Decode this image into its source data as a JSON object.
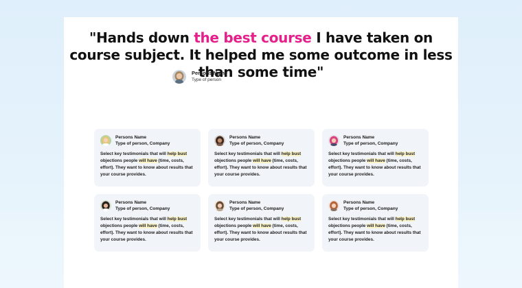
{
  "hero": {
    "quote_part1": "\"Hands down ",
    "quote_highlight": "the best course",
    "quote_part2": " I have taken on course subject. It helped me some outcome in less than some time\"",
    "person_name": "Persons Name",
    "person_type": "Type of person",
    "avatar_icon": "woman-portrait-avatar"
  },
  "colors": {
    "accent": "#e5208a",
    "card_bg": "#f1f4f8",
    "highlight": "#fbf3c8"
  },
  "testimonials": [
    {
      "name": "Persons Name",
      "type": "Type of person, Company",
      "text_a": "Select key testimonials that will ",
      "text_mark1": "help bust",
      "text_b": " objections people ",
      "text_mark2": "will have",
      "text_c": " (time, costs, effort). They want to know about results that your course provides.",
      "avatar_icon": "blonde-woman-avatar"
    },
    {
      "name": "Persons Name",
      "type": "Type of person, Company",
      "text_a": "Select key testimonials that will ",
      "text_mark1": "help bust",
      "text_b": " objections people ",
      "text_mark2": "will have",
      "text_c": " (time, costs, effort). They want to know about results that your course provides.",
      "avatar_icon": "curly-hair-woman-avatar"
    },
    {
      "name": "Persons Name",
      "type": "Type of person, Company",
      "text_a": "Select key testimonials that will ",
      "text_mark1": "help bust",
      "text_b": " objections people ",
      "text_mark2": "will have",
      "text_c": " (time, costs, effort). They want to know about results that your course provides.",
      "avatar_icon": "pink-hair-woman-avatar"
    },
    {
      "name": "Persons Name",
      "type": "Type of person, Company",
      "text_a": "Select key testimonials that will ",
      "text_mark1": "help bust",
      "text_b": " objections people ",
      "text_mark2": "will have",
      "text_c": " (time, costs, effort). They want to know about results that your course provides.",
      "avatar_icon": "dark-hair-woman-avatar"
    },
    {
      "name": "Persons Name",
      "type": "Type of person, Company",
      "text_a": "Select key testimonials that will ",
      "text_mark1": "help bust",
      "text_b": " objections people ",
      "text_mark2": "will have",
      "text_c": " (time, costs, effort). They want to know about results that your course provides.",
      "avatar_icon": "brown-hair-woman-avatar"
    },
    {
      "name": "Persons Name",
      "type": "Type of person, Company",
      "text_a": "Select key testimonials that will ",
      "text_mark1": "help bust",
      "text_b": " objections people ",
      "text_mark2": "will have",
      "text_c": " (time, costs, effort). They want to know about results that your course provides.",
      "avatar_icon": "red-hair-woman-avatar"
    }
  ]
}
